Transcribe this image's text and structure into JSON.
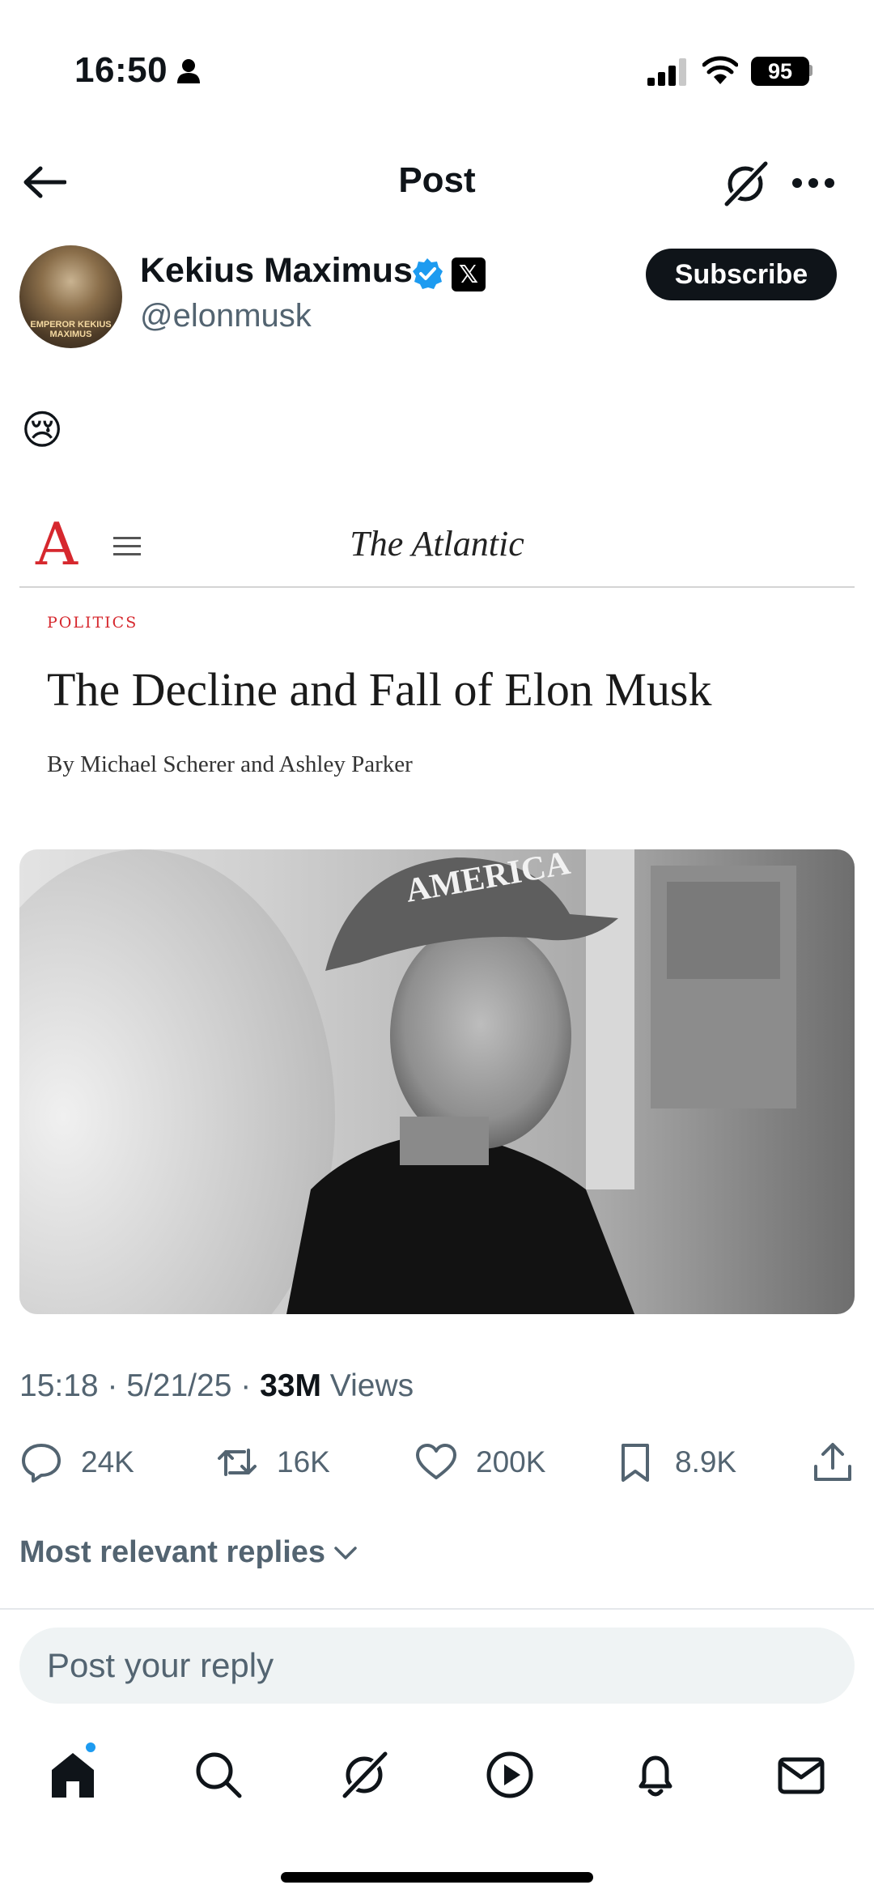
{
  "status_bar": {
    "time": "16:50",
    "battery": "95"
  },
  "header": {
    "title": "Post"
  },
  "author": {
    "name": "Kekius Maximus",
    "handle": "@elonmusk",
    "avatar_caption": "EMPEROR KEKIUS MAXIMUS",
    "subscribe_label": "Subscribe"
  },
  "post": {
    "text": "😢",
    "article": {
      "logo": "A",
      "publication": "The Atlantic",
      "section": "POLITICS",
      "headline": "The Decline and Fall of Elon Musk",
      "byline": "By Michael Scherer and Ashley Parker",
      "photo_cap_text": "AMERICA"
    },
    "time": "15:18",
    "date": "5/21/25",
    "views_count": "33M",
    "views_label": "Views"
  },
  "actions": {
    "replies": "24K",
    "reposts": "16K",
    "likes": "200K",
    "bookmarks": "8.9K"
  },
  "replies_sort_label": "Most relevant replies",
  "reply_placeholder": "Post your reply",
  "nav": {
    "items": [
      "home-icon",
      "search-icon",
      "grok-icon",
      "video-icon",
      "notifications-icon",
      "messages-icon"
    ],
    "home_notification_color": "#1d9bf0"
  },
  "colors": {
    "text": "#0f1419",
    "secondary": "#536471",
    "verified": "#1d9bf0",
    "atlantic_red": "#d6282e"
  }
}
